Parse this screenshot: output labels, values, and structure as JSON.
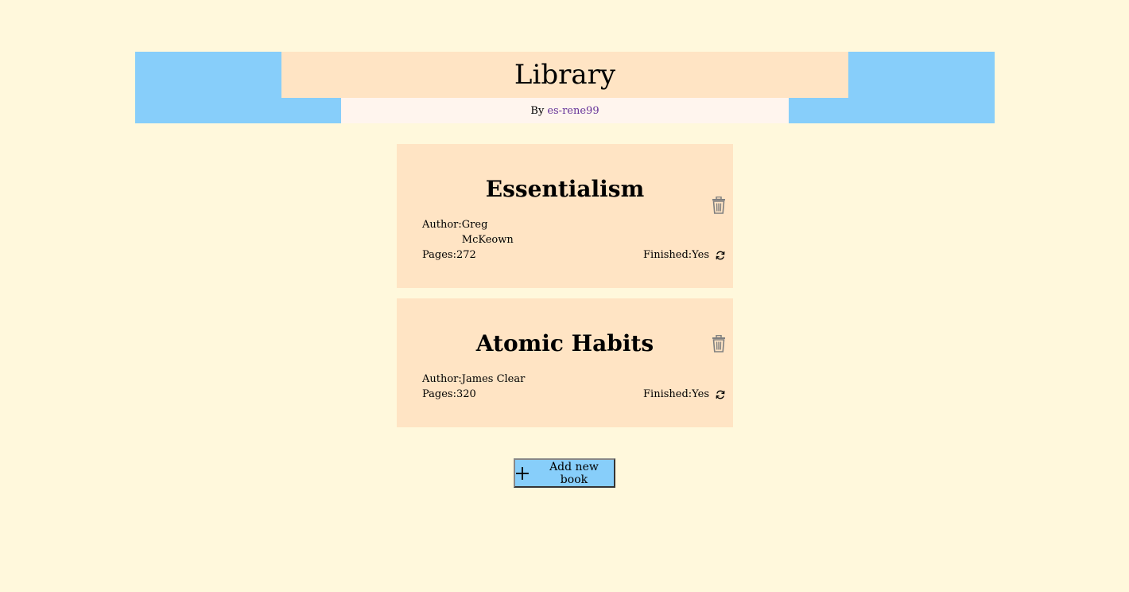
{
  "header": {
    "title": "Library",
    "by_label": "By",
    "author_link": "es-rene99"
  },
  "books": [
    {
      "title": "Essentialism",
      "author_label": "Author:",
      "author": "Greg McKeown",
      "pages_label": "Pages:",
      "pages": "272",
      "finished_label": "Finished:",
      "finished": "Yes"
    },
    {
      "title": "Atomic Habits",
      "author_label": "Author:",
      "author": "James Clear",
      "pages_label": "Pages:",
      "pages": "320",
      "finished_label": "Finished:",
      "finished": "Yes"
    }
  ],
  "add_button": {
    "label": "Add new book",
    "icon": "plus-icon"
  },
  "colors": {
    "background": "#fff8dc",
    "header_band": "#87cefa",
    "card": "#ffe4c4",
    "link": "#663399"
  }
}
